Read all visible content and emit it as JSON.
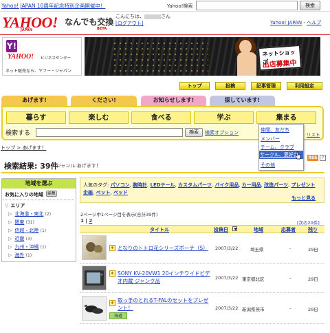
{
  "topbar": {
    "promo": "Yahoo! JAPAN 10周年記念特別企画開催中！",
    "search_label": "Yahoo!検索",
    "search_button": "検索"
  },
  "header": {
    "logo": "YAHOO!",
    "logo_sub": "JAPAN",
    "brand": "なんでも交換",
    "beta": "BETA",
    "greeting_prefix": "こんにちは、",
    "greeting_suffix": "さん",
    "logout": "[ログアウト]",
    "yahoo_japan_link": "Yahoo! JAPAN",
    "help_link": "ヘルプ",
    "link_separator": " - "
  },
  "banner": {
    "badge": "Y!",
    "logo": "YAHOO!",
    "center_name": "ビジネスセンター",
    "caption": "ネット販売なら、ヤフー・ジャパン",
    "sign_line1": "ネットショップ",
    "sign_line2": "出店募集中"
  },
  "nav": {
    "buttons": [
      "トップ",
      "投稿",
      "記事管理",
      "利用設定"
    ]
  },
  "tabs": [
    "あげます!",
    "ください!",
    "お知らせします!",
    "探しています!"
  ],
  "categories": [
    "暮らす",
    "楽しむ",
    "食べる",
    "学ぶ",
    "集まる"
  ],
  "keyword": {
    "label": "検索する",
    "button": "検索",
    "option_link": "検索オプション",
    "list_link": "リスト"
  },
  "dropdown": {
    "items": [
      "仲間、友だち",
      "メンバー",
      "チーム、クラブ",
      "サークル、愛好会",
      "その他"
    ],
    "highlighted_index": 3
  },
  "breadcrumb": "トップ > あげます！",
  "results": {
    "title": "検索結果: 39件",
    "subtitle": "- ジャンル:あげます！",
    "rss": "RSS",
    "help": "?"
  },
  "sidebar": {
    "header": "地域を選ぶ",
    "favorites": "お気に入りの地域",
    "edit_button": "編集",
    "area_label": "エリア",
    "areas": [
      {
        "name": "北海道・東北",
        "count": "(2)"
      },
      {
        "name": "関東",
        "count": "(31)"
      },
      {
        "name": "信越・北陸",
        "count": "(1)"
      },
      {
        "name": "近畿",
        "count": "(3)"
      },
      {
        "name": "九州・沖縄",
        "count": "(1)"
      },
      {
        "name": "海外",
        "count": "(1)"
      }
    ]
  },
  "tags": {
    "label": "人気のタグ:",
    "items": [
      "パソコン",
      "腕時計",
      "LEDテール",
      "カスタムパーツ",
      "バイク用品",
      "カー用品",
      "改造パーツ",
      "プレゼント企画",
      "ペット",
      "ペッド"
    ],
    "more": "もっと見る"
  },
  "table": {
    "page_info": "2ページ中1ページ目を表示(合計39件)",
    "pager_current": "1",
    "pager_sep": " | ",
    "pager_next": "2",
    "next_link": "[次の20件]",
    "headers": {
      "title": "タイトル",
      "date": "投稿日",
      "region": "地域",
      "applicants": "応募者",
      "remaining": "残り"
    },
    "rows": [
      {
        "title": "となりのトトロ花シリーズポーチ（S）",
        "date": "2007/3/22",
        "region": "埼玉県",
        "applicants": "-",
        "remaining": "29日"
      },
      {
        "title": "SONY KV-20VW1 20インチワイドビデオ内蔵 ジャンク品",
        "date": "2007/3/22",
        "region": "東京都北区",
        "applicants": "-",
        "remaining": "29日"
      },
      {
        "title": "取っ手のとれるT-FALのセットをプレゼント！",
        "date": "2007/3/22",
        "region": "新潟県燕市",
        "applicants": "-",
        "remaining": "29日",
        "badge": "海道"
      }
    ]
  },
  "colors": {
    "yahoo_red": "#e0101b",
    "link_blue": "#1a3dc1",
    "panel_yellow": "#fffbd2",
    "sidebar_green": "#c4e34a"
  }
}
